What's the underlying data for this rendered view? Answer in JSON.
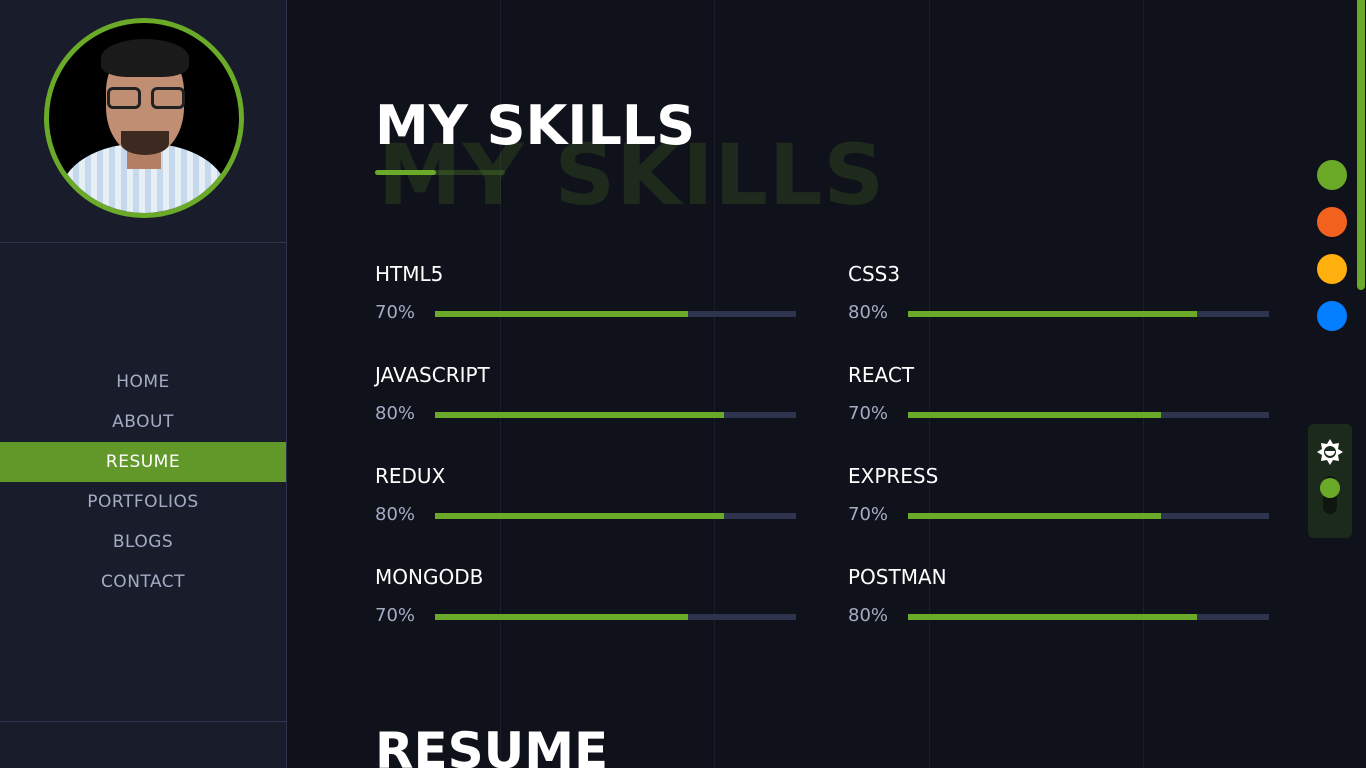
{
  "sidebar": {
    "avatar_alt": "Profile photo",
    "nav": [
      {
        "label": "HOME",
        "active": false
      },
      {
        "label": "ABOUT",
        "active": false
      },
      {
        "label": "RESUME",
        "active": true
      },
      {
        "label": "PORTFOLIOS",
        "active": false
      },
      {
        "label": "BLOGS",
        "active": false
      },
      {
        "label": "CONTACT",
        "active": false
      }
    ]
  },
  "skills_section": {
    "title": "MY SKILLS",
    "shadow_title": "MY SKILLS",
    "skills": [
      {
        "name": "HTML5",
        "percent_label": "70%",
        "value": 70
      },
      {
        "name": "CSS3",
        "percent_label": "80%",
        "value": 80
      },
      {
        "name": "JAVASCRIPT",
        "percent_label": "80%",
        "value": 80
      },
      {
        "name": "REACT",
        "percent_label": "70%",
        "value": 70
      },
      {
        "name": "REDUX",
        "percent_label": "80%",
        "value": 80
      },
      {
        "name": "EXPRESS",
        "percent_label": "70%",
        "value": 70
      },
      {
        "name": "MONGODB",
        "percent_label": "70%",
        "value": 70
      },
      {
        "name": "POSTMAN",
        "percent_label": "80%",
        "value": 80
      }
    ]
  },
  "resume_section": {
    "title": "RESUME"
  },
  "theme": {
    "accent": "#6aaa28",
    "color_options": [
      "#6aaa28",
      "#f2611d",
      "#ffb00f",
      "#037fff"
    ],
    "mode": "dark",
    "mode_icon": "sun-icon"
  }
}
